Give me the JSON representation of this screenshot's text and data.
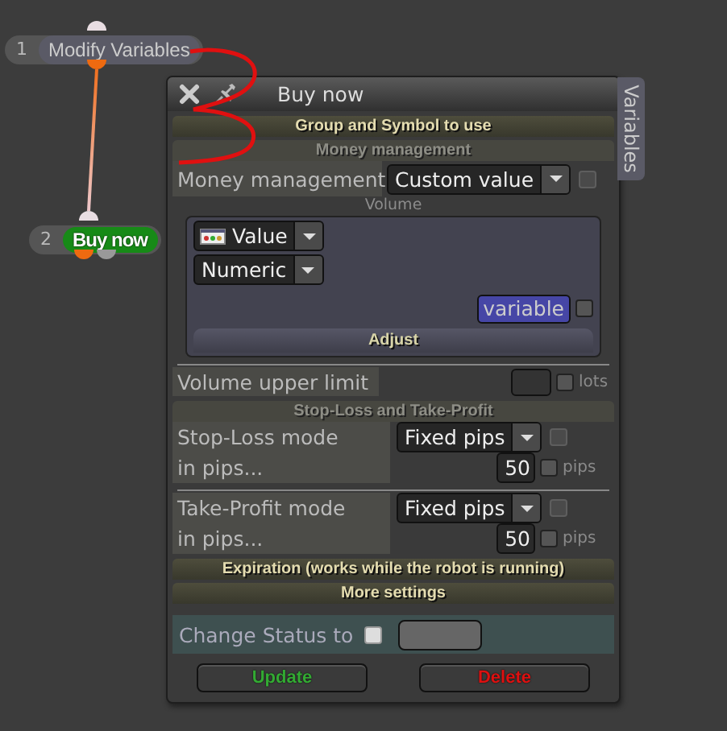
{
  "nodes": [
    {
      "number": "1",
      "label": "Modify Variables",
      "selected": false
    },
    {
      "number": "2",
      "label": "Buy now",
      "selected": true
    }
  ],
  "panel": {
    "title": "Buy now",
    "side_tab": "Variables",
    "group_header": "Group and Symbol to use",
    "money": {
      "header": "Money management",
      "label": "Money management",
      "select": "Custom value",
      "checkbox": {
        "checked": false,
        "disabled": true
      },
      "volume": {
        "caption": "Volume",
        "type_select": "Value",
        "format_select": "Numeric",
        "variable_button": "variable",
        "variable_checkbox": {
          "checked": false,
          "disabled": false
        },
        "adjust": "Adjust"
      },
      "upper_limit": {
        "label": "Volume upper limit",
        "unit": "lots",
        "checkbox": {
          "checked": false,
          "disabled": false
        }
      }
    },
    "stops": {
      "header": "Stop-Loss and Take-Profit",
      "rows": [
        {
          "label": "Stop-Loss mode",
          "select": "Fixed pips",
          "checkbox": {
            "checked": false,
            "disabled": true
          },
          "sublabel": "in pips...",
          "value": "50",
          "unit": "pips",
          "unit_checkbox": {
            "checked": false,
            "disabled": false
          }
        },
        {
          "label": "Take-Profit mode",
          "select": "Fixed pips",
          "checkbox": {
            "checked": false,
            "disabled": true
          },
          "sublabel": "in pips...",
          "value": "50",
          "unit": "pips",
          "unit_checkbox": {
            "checked": false,
            "disabled": false
          }
        }
      ]
    },
    "collapsed_headers": [
      "Expiration (works while the robot is running)",
      "More settings"
    ],
    "status": {
      "label": "Change Status to",
      "checkbox": {
        "checked": false,
        "disabled": false
      }
    },
    "buttons": [
      {
        "label": "Update",
        "kind": "update"
      },
      {
        "label": "Delete",
        "kind": "delete"
      }
    ]
  }
}
